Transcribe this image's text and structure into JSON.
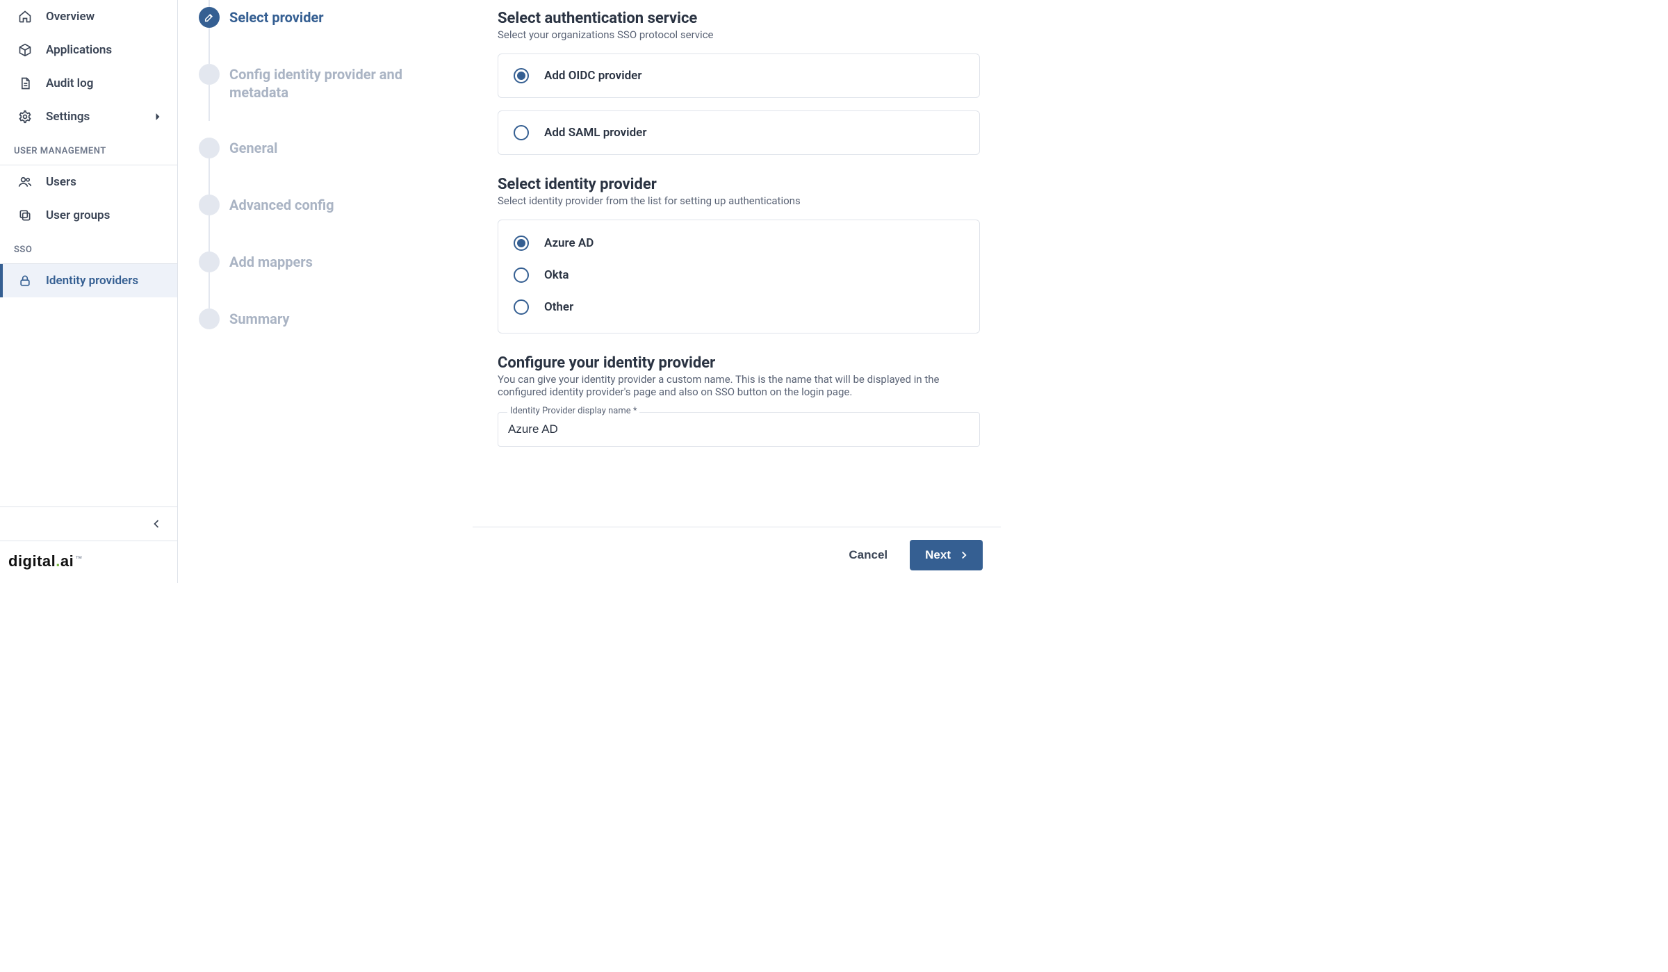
{
  "sidebar": {
    "items": [
      {
        "id": "overview",
        "label": "Overview"
      },
      {
        "id": "applications",
        "label": "Applications"
      },
      {
        "id": "audit-log",
        "label": "Audit log"
      },
      {
        "id": "settings",
        "label": "Settings",
        "expandable": true
      }
    ],
    "section_user_mgmt": "USER MANAGEMENT",
    "user_items": [
      {
        "id": "users",
        "label": "Users"
      },
      {
        "id": "user-groups",
        "label": "User groups"
      }
    ],
    "section_sso": "SSO",
    "sso_items": [
      {
        "id": "identity-providers",
        "label": "Identity providers",
        "active": true
      }
    ],
    "brand": "digital.ai"
  },
  "stepper": [
    {
      "id": "select-provider",
      "label": "Select provider",
      "active": true
    },
    {
      "id": "config-idp",
      "label": "Config identity provider and metadata"
    },
    {
      "id": "general",
      "label": "General"
    },
    {
      "id": "advanced",
      "label": "Advanced config"
    },
    {
      "id": "mappers",
      "label": "Add mappers"
    },
    {
      "id": "summary",
      "label": "Summary"
    }
  ],
  "auth_service": {
    "title": "Select authentication service",
    "subtitle": "Select your organizations SSO protocol service",
    "options": [
      {
        "id": "oidc",
        "label": "Add OIDC provider",
        "selected": true
      },
      {
        "id": "saml",
        "label": "Add SAML provider",
        "selected": false
      }
    ]
  },
  "idp": {
    "title": "Select identity provider",
    "subtitle": "Select identity provider from the list for setting up authentications",
    "options": [
      {
        "id": "azure",
        "label": "Azure AD",
        "selected": true
      },
      {
        "id": "okta",
        "label": "Okta",
        "selected": false
      },
      {
        "id": "other",
        "label": "Other",
        "selected": false
      }
    ]
  },
  "configure": {
    "title": "Configure your identity provider",
    "subtitle": "You can give your identity provider a custom name. This is the name that will be displayed in the configured identity provider's page and also on SSO button on the login page.",
    "field_label": "Identity Provider display name *",
    "field_value": "Azure AD"
  },
  "footer": {
    "cancel": "Cancel",
    "next": "Next"
  }
}
